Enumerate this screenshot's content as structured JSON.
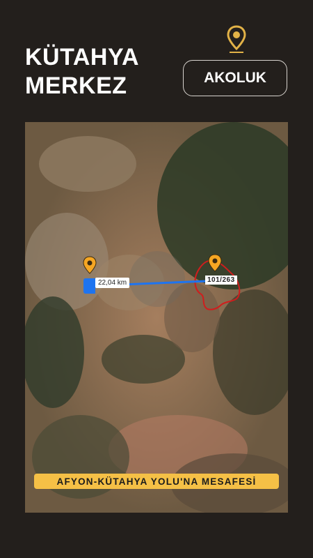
{
  "header": {
    "title_line1": "KÜTAHYA",
    "title_line2": "MERKEZ",
    "location_button": "AKOLUK"
  },
  "map": {
    "distance_label": "22,04 km",
    "road_label": "101/263",
    "caption": "AFYON-KÜTAHYA YOLU'NA MESAFESİ"
  },
  "colors": {
    "background": "#231f1c",
    "accent": "#f5c046",
    "route": "#1e74f0",
    "boundary": "#d01d1d"
  },
  "icons": [
    "location-pin-icon",
    "map-pin-icon"
  ]
}
